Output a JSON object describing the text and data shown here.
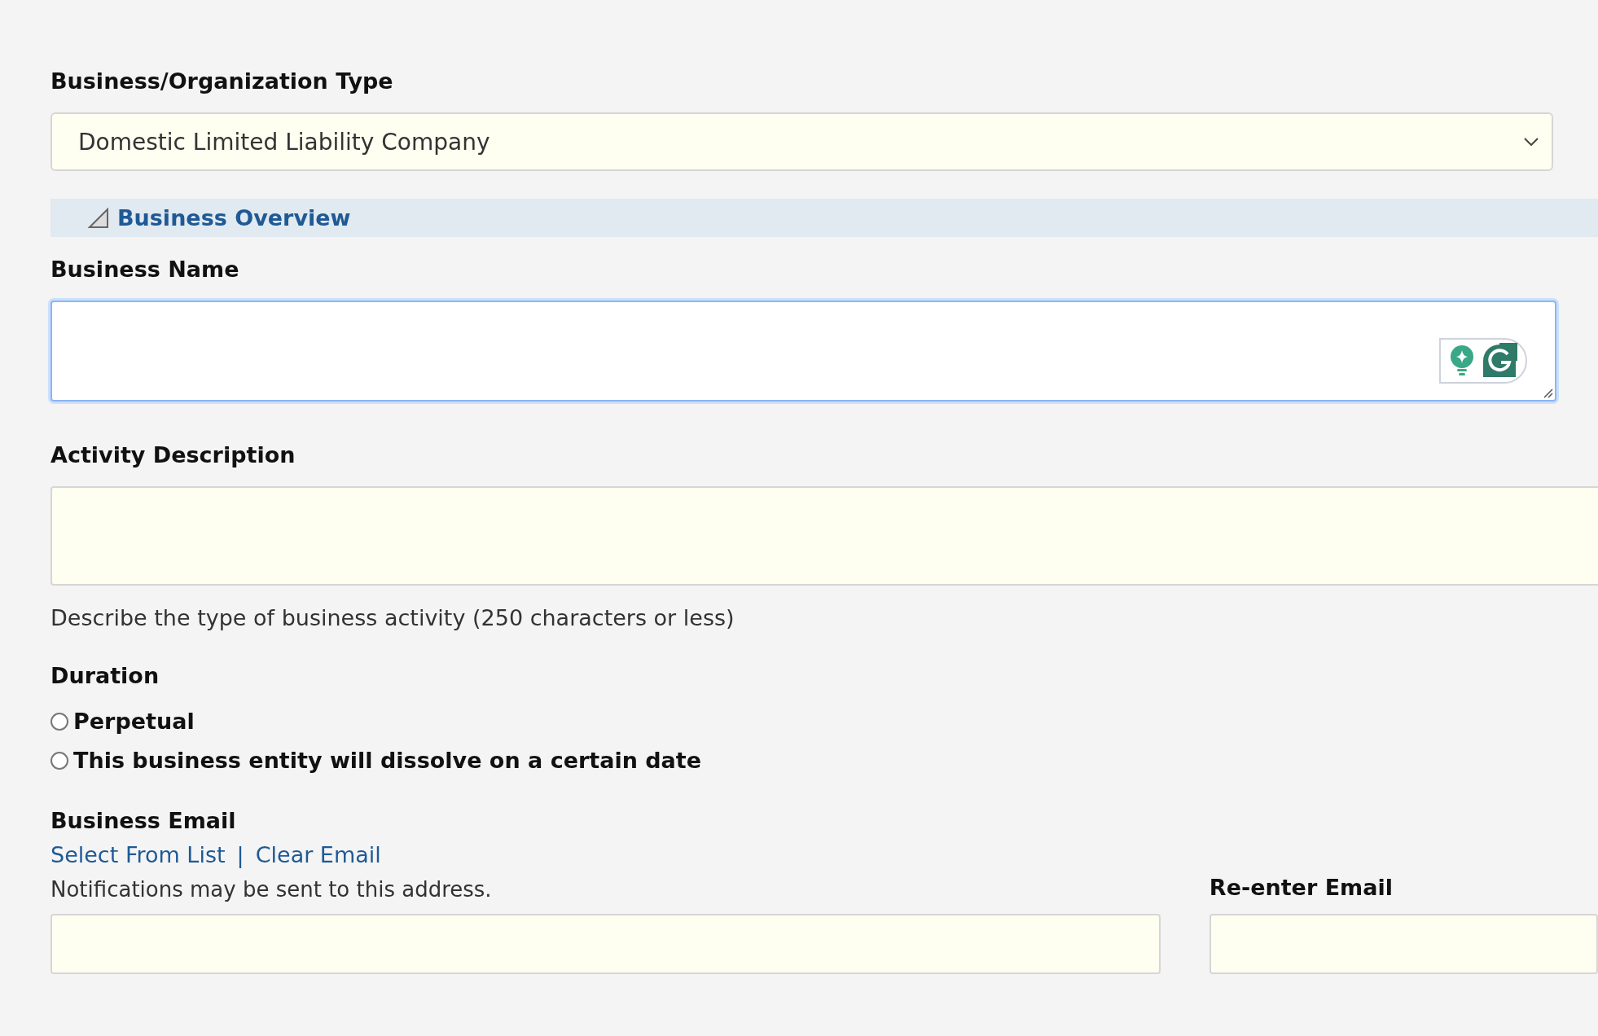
{
  "business_type": {
    "label": "Business/Organization Type",
    "value": "Domestic Limited Liability Company"
  },
  "section": {
    "title": "Business Overview",
    "expanded": true
  },
  "business_name": {
    "label": "Business Name",
    "focused": true
  },
  "activity": {
    "label": "Activity Description",
    "help": "Describe the type of business activity (250 characters or less)"
  },
  "duration": {
    "label": "Duration",
    "options": [
      {
        "label": "Perpetual",
        "selected": false
      },
      {
        "label": "This business entity will dissolve on a certain date",
        "selected": false
      }
    ]
  },
  "email": {
    "label": "Business Email",
    "links": [
      "Select From List",
      "Clear Email"
    ],
    "separator": "|",
    "note": "Notifications may be sent to this address."
  },
  "reenter_email": {
    "label": "Re-enter Email"
  }
}
